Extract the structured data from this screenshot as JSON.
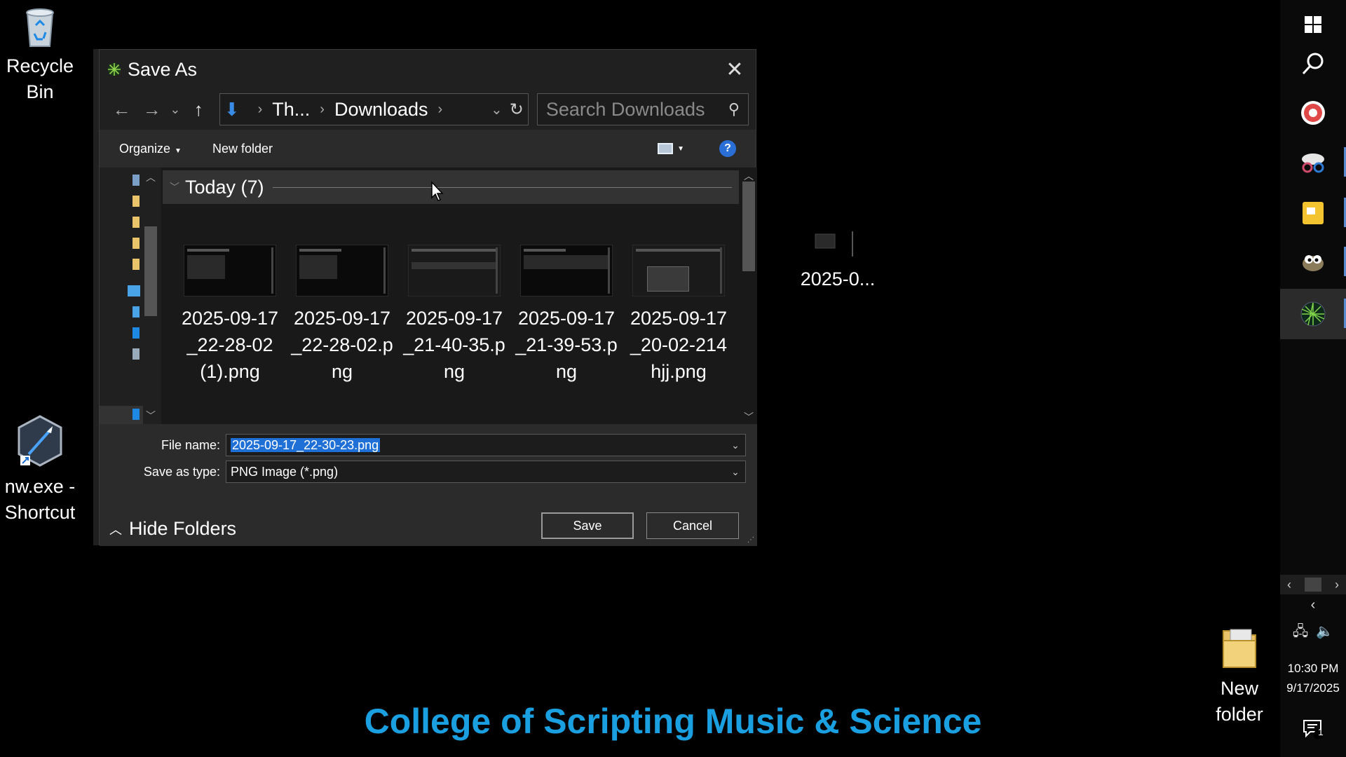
{
  "desktop": {
    "recycle_bin_label": "Recycle Bin",
    "nw_shortcut_label": "nw.exe - Shortcut",
    "file_label": "2025-0...",
    "new_folder_label": "New folder",
    "banner_text": "College of Scripting Music & Science"
  },
  "dialog": {
    "title": "Save As",
    "breadcrumb": {
      "part1": "Th...",
      "part2": "Downloads"
    },
    "search_placeholder": "Search Downloads",
    "toolbar": {
      "organize": "Organize",
      "new_folder": "New folder",
      "help": "?"
    },
    "group": {
      "title": "Today (7)"
    },
    "files": [
      {
        "name": "2025-09-17_22-28-02 (1).png"
      },
      {
        "name": "2025-09-17_22-28-02.png"
      },
      {
        "name": "2025-09-17_21-40-35.png"
      },
      {
        "name": "2025-09-17_21-39-53.png"
      },
      {
        "name": "2025-09-17_20-02-214hjj.png"
      }
    ],
    "file_name_label": "File name:",
    "file_name_value": "2025-09-17_22-30-23.png",
    "save_type_label": "Save as type:",
    "save_type_value": "PNG Image (*.png)",
    "hide_folders": "Hide Folders",
    "save_button": "Save",
    "cancel_button": "Cancel"
  },
  "taskbar": {
    "time": "10:30 PM",
    "date": "9/17/2025",
    "notification_count": "1"
  },
  "colors": {
    "accent": "#1e6fd6",
    "banner": "#1aa0e0",
    "help": "#2a6fd6"
  }
}
